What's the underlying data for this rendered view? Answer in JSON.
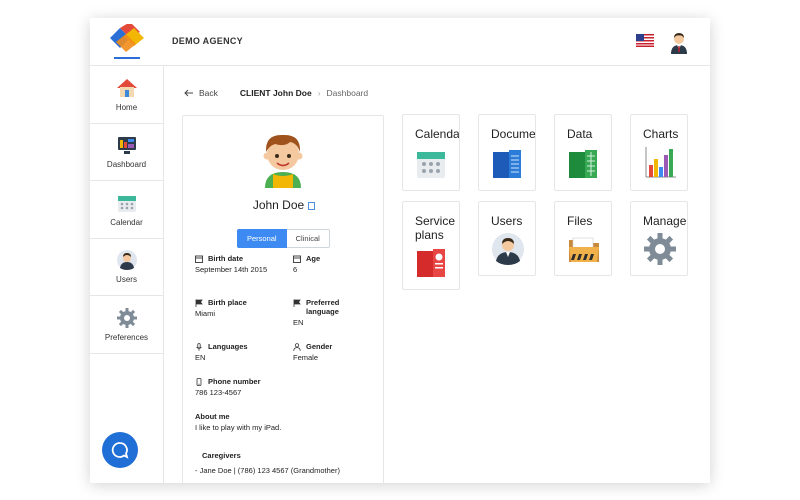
{
  "header": {
    "agency_name": "DEMO AGENCY",
    "flag_icon": "us-flag-icon",
    "avatar_icon": "user-avatar-icon"
  },
  "sidebar": {
    "items": [
      {
        "label": "Home",
        "icon": "home-icon"
      },
      {
        "label": "Dashboard",
        "icon": "dashboard-icon"
      },
      {
        "label": "Calendar",
        "icon": "calendar-icon"
      },
      {
        "label": "Users",
        "icon": "users-icon"
      },
      {
        "label": "Preferences",
        "icon": "gear-icon"
      }
    ],
    "chat_icon": "chat-icon"
  },
  "breadcrumb": {
    "back": "Back",
    "client": "CLIENT John Doe",
    "current": "Dashboard"
  },
  "profile": {
    "name": "John Doe",
    "tabs": [
      "Personal",
      "Clinical"
    ],
    "active_tab": "Personal",
    "birth_date_label": "Birth date",
    "birth_date": "September 14th 2015",
    "age_label": "Age",
    "age": "6",
    "birth_place_label": "Birth place",
    "birth_place": "Miami",
    "preferred_language_label": "Preferred language",
    "preferred_language": "EN",
    "languages_label": "Languages",
    "languages": "EN",
    "gender_label": "Gender",
    "gender": "Female",
    "phone_label": "Phone number",
    "phone": "786 123-4567",
    "about_label": "About me",
    "about": "I like to play with my iPad.",
    "caregivers_label": "Caregivers",
    "caregivers": [
      "- Jane Doe | (786) 123 4567 (Grandmother)"
    ]
  },
  "tiles": [
    {
      "label": "Calenda",
      "icon": "calendar-icon"
    },
    {
      "label": "Docume",
      "icon": "documents-icon"
    },
    {
      "label": "Data",
      "icon": "spreadsheet-icon"
    },
    {
      "label": "Charts",
      "icon": "bar-chart-icon"
    },
    {
      "label": "Service plans",
      "icon": "presentation-icon"
    },
    {
      "label": "Users",
      "icon": "user-icon"
    },
    {
      "label": "Files",
      "icon": "folder-icon"
    },
    {
      "label": "Manage",
      "icon": "gear-icon"
    }
  ],
  "colors": {
    "accent": "#3d8bf2",
    "chat_button": "#1f6fd6"
  }
}
